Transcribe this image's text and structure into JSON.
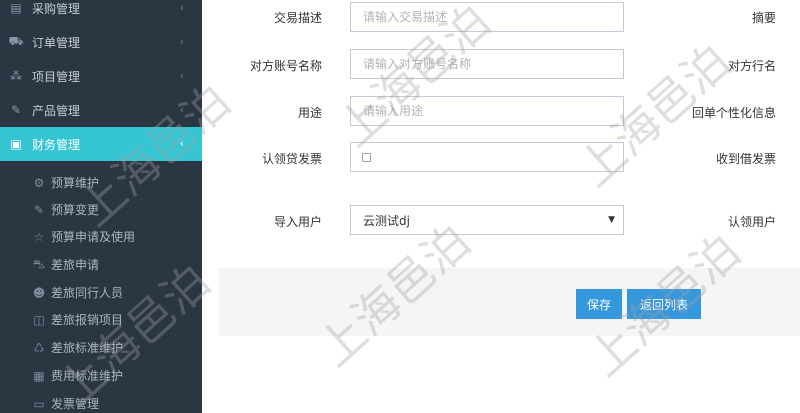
{
  "sidebar": {
    "menu": [
      {
        "label": "采购管理",
        "icon": "clipboard-icon",
        "chevron": "‹"
      },
      {
        "label": "订单管理",
        "icon": "cart-icon",
        "chevron": "‹"
      },
      {
        "label": "项目管理",
        "icon": "sitemap-icon",
        "chevron": "‹"
      },
      {
        "label": "产品管理",
        "icon": "edit-icon",
        "chevron": "‹"
      },
      {
        "label": "财务管理",
        "icon": "money-icon",
        "chevron": "‹"
      }
    ],
    "sub": [
      {
        "label": "预算维护",
        "icon": "gear-icon"
      },
      {
        "label": "预算变更",
        "icon": "edit-icon"
      },
      {
        "label": "预算申请及使用",
        "icon": "star-icon"
      },
      {
        "label": "差旅申请",
        "icon": "car-icon"
      },
      {
        "label": "差旅同行人员",
        "icon": "users-icon"
      },
      {
        "label": "差旅报销项目",
        "icon": "tag-icon"
      },
      {
        "label": "差旅标准维护",
        "icon": "refresh-icon"
      },
      {
        "label": "费用标准维护",
        "icon": "box-icon"
      },
      {
        "label": "发票管理",
        "icon": "card-icon"
      }
    ]
  },
  "form": {
    "desc_label": "交易描述",
    "desc_placeholder": "请输入交易描述",
    "summary_label": "摘要",
    "account_name_label": "对方账号名称",
    "account_name_placeholder": "请输入对方账号名称",
    "bank_label": "对方行名",
    "purpose_label": "用途",
    "purpose_placeholder": "请输入用途",
    "personal_info_label": "回单个性化信息",
    "claim_invoice_label": "认领贷发票",
    "collect_invoice_label": "收到借发票",
    "import_user_label": "导入用户",
    "import_user_value": "云测试dj",
    "claim_user_label": "认领用户"
  },
  "actions": {
    "save": "保存",
    "back": "返回列表"
  },
  "watermark": "上海邑泊"
}
